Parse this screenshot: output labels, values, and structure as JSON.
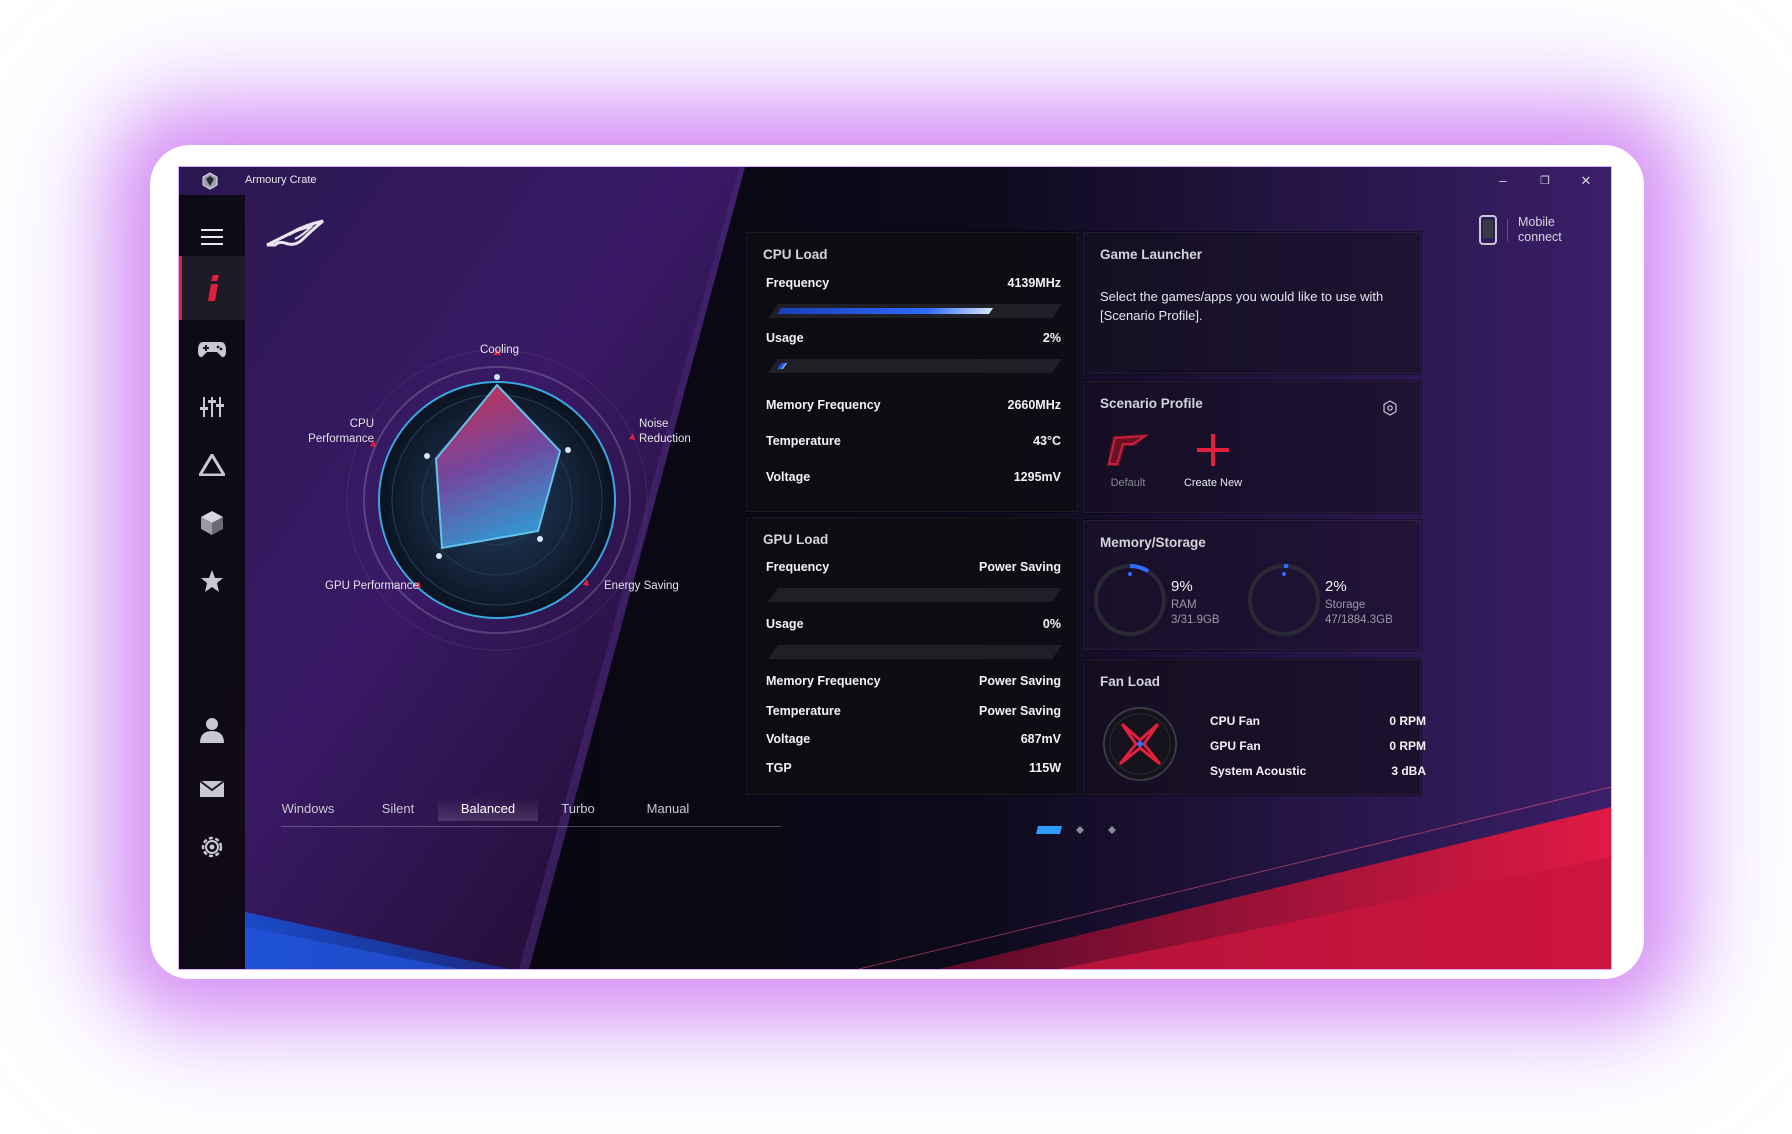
{
  "window": {
    "title": "Armoury Crate",
    "controls": {
      "minimize": "–",
      "restore": "❐",
      "close": "✕"
    }
  },
  "sidebar": {
    "items": [
      {
        "icon": "menu-icon"
      },
      {
        "icon": "home-icon",
        "active": true
      },
      {
        "icon": "gamepad-icon"
      },
      {
        "icon": "sliders-icon"
      },
      {
        "icon": "aura-icon"
      },
      {
        "icon": "box-icon"
      },
      {
        "icon": "star-icon"
      },
      {
        "icon": "user-icon"
      },
      {
        "icon": "mail-icon"
      },
      {
        "icon": "settings-icon"
      }
    ]
  },
  "mobile_connect": {
    "line1": "Mobile",
    "line2": "connect"
  },
  "radar": {
    "labels": {
      "cooling": "Cooling",
      "noise_line1": "Noise",
      "noise_line2": "Reduction",
      "energy": "Energy Saving",
      "gpu": "GPU Performance",
      "cpu_line1": "CPU",
      "cpu_line2": "Performance"
    }
  },
  "modes": {
    "items": [
      "Windows",
      "Silent",
      "Balanced",
      "Turbo",
      "Manual"
    ],
    "active": "Balanced"
  },
  "cpu_load": {
    "title": "CPU Load",
    "frequency_label": "Frequency",
    "frequency_value": "4139MHz",
    "frequency_level": 0.78,
    "usage_label": "Usage",
    "usage_value": "2%",
    "usage_level": 0.02,
    "memfreq_label": "Memory Frequency",
    "memfreq_value": "2660MHz",
    "temp_label": "Temperature",
    "temp_value": "43°C",
    "voltage_label": "Voltage",
    "voltage_value": "1295mV"
  },
  "gpu_load": {
    "title": "GPU Load",
    "frequency_label": "Frequency",
    "frequency_value": "Power Saving",
    "usage_label": "Usage",
    "usage_value": "0%",
    "memfreq_label": "Memory Frequency",
    "memfreq_value": "Power Saving",
    "temp_label": "Temperature",
    "temp_value": "Power Saving",
    "voltage_label": "Voltage",
    "voltage_value": "687mV",
    "tgp_label": "TGP",
    "tgp_value": "115W"
  },
  "game_launcher": {
    "title": "Game Launcher",
    "text": "Select the games/apps you would like to use with [Scenario Profile]."
  },
  "scenario_profile": {
    "title": "Scenario Profile",
    "default_label": "Default",
    "create_label": "Create New"
  },
  "memory_storage": {
    "title": "Memory/Storage",
    "ram_percent": "9%",
    "ram_label": "RAM",
    "ram_detail": "3/31.9GB",
    "ram_level": 0.09,
    "storage_percent": "2%",
    "storage_label": "Storage",
    "storage_detail": "47/1884.3GB",
    "storage_level": 0.02
  },
  "fan_load": {
    "title": "Fan Load",
    "cpu_fan_label": "CPU Fan",
    "cpu_fan_value": "0 RPM",
    "gpu_fan_label": "GPU Fan",
    "gpu_fan_value": "0 RPM",
    "acoustic_label": "System Acoustic",
    "acoustic_value": "3 dBA"
  },
  "colors": {
    "accent_red": "#e0203c",
    "accent_blue": "#2e6bff",
    "panel_bg": "#0e0e12"
  }
}
